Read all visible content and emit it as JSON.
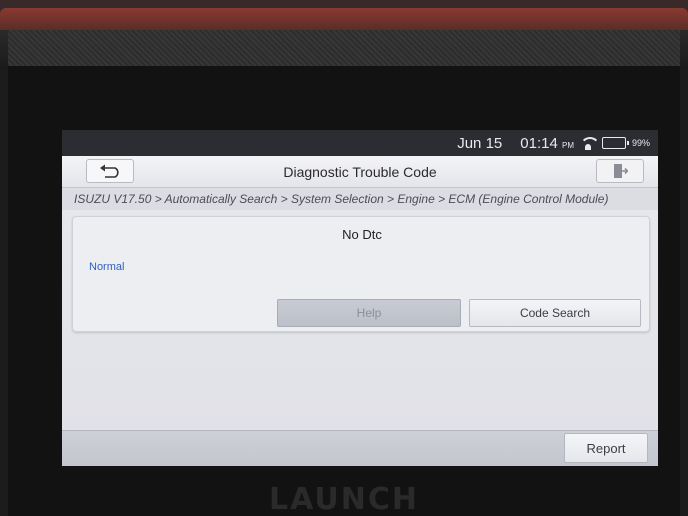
{
  "device": {
    "brand": "LAUNCH"
  },
  "status_bar": {
    "date": "Jun 15",
    "time": "01:14",
    "ampm": "PM",
    "battery": "99%",
    "icons": [
      "wifi-icon",
      "battery-icon"
    ]
  },
  "header": {
    "title": "Diagnostic Trouble Code",
    "back_icon": "back-arrow-icon",
    "exit_icon": "exit-door-icon"
  },
  "breadcrumb": "ISUZU V17.50 > Automatically Search > System Selection > Engine > ECM (Engine Control Module)",
  "dtc": {
    "title": "No Dtc",
    "status": "Normal",
    "help_label": "Help",
    "code_search_label": "Code Search"
  },
  "footer": {
    "report_label": "Report"
  },
  "colors": {
    "status_text": "#2f5fbf",
    "status_bar_bg": "#2c2c33",
    "screen_bg": "#d7d9df"
  }
}
